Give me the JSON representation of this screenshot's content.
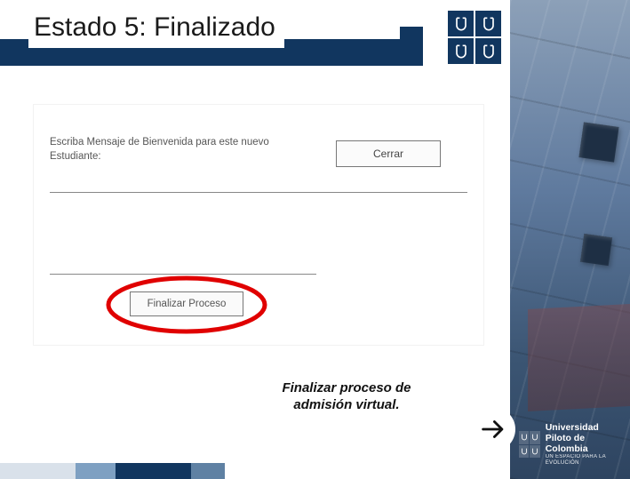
{
  "header": {
    "title": "Estado 5: Finalizado"
  },
  "screenshot": {
    "prompt_line1": "Escriba Mensaje de Bienvenida para este nuevo",
    "prompt_line2": "Estudiante:",
    "close_label": "Cerrar",
    "finalize_label": "Finalizar Proceso"
  },
  "caption": {
    "line1": "Finalizar proceso de",
    "line2": "admisión virtual."
  },
  "footer": {
    "brand_top": "Universidad",
    "brand_bottom": "Piloto de Colombia",
    "tagline": "UN ESPACIO PARA LA EVOLUCIÓN"
  }
}
